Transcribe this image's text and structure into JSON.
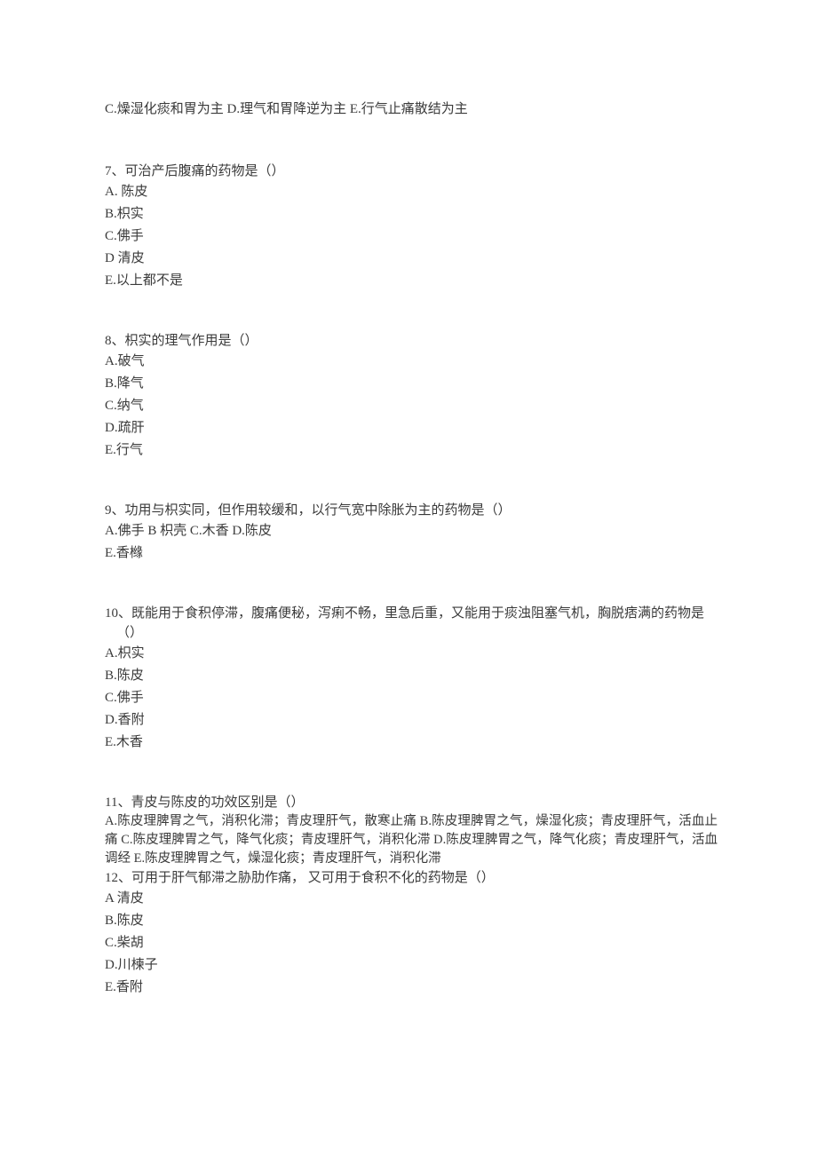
{
  "document": {
    "type": "exam-question-sheet",
    "language": "zh-CN",
    "top_fragment": "C.燥湿化痰和胃为主 D.理气和胃降逆为主 E.行气止痛散结为主"
  },
  "questions": [
    {
      "number": "7",
      "stem": "7、可治产后腹痛的药物是（）",
      "options": [
        "A. 陈皮",
        "B.枳实",
        "C.佛手",
        "D 清皮",
        "E.以上都不是"
      ]
    },
    {
      "number": "8",
      "stem": "8、枳实的理气作用是（）",
      "options": [
        "A.破气",
        "B.降气",
        "C.纳气",
        "D.疏肝",
        "E.行气"
      ]
    },
    {
      "number": "9",
      "stem": "9、功用与枳实同，但作用较缓和，以行气宽中除胀为主的药物是（）",
      "inline_options": "A.佛手 B 枳壳 C.木香 D.陈皮",
      "options": [
        "E.香橼"
      ]
    },
    {
      "number": "10",
      "stem": "10、既能用于食积停滞，腹痛便秘，泻痢不畅，里急后重，又能用于痰浊阻塞气机，胸脱痞满的药物是（）",
      "options": [
        "A.枳实",
        "B.陈皮",
        "C.佛手",
        "D.香附",
        "E.木香"
      ]
    },
    {
      "number": "11",
      "stem": "11、青皮与陈皮的功效区别是（）",
      "paragraph_options": "A.陈皮理脾胃之气，消积化滞；青皮理肝气，散寒止痛 B.陈皮理脾胃之气，燥湿化痰；青皮理肝气，活血止痛 C.陈皮理脾胃之气，降气化痰；青皮理肝气，消积化滞 D.陈皮理脾胃之气，降气化痰；青皮理肝气，活血调经 E.陈皮理脾胃之气，燥湿化痰；青皮理肝气，消积化滞"
    },
    {
      "number": "12",
      "stem": "12、可用于肝气郁滞之胁肋作痛， 又可用于食积不化的药物是（）",
      "options": [
        "A 清皮",
        "B.陈皮",
        "C.柴胡",
        "D.川楝子",
        "E.香附"
      ]
    }
  ]
}
